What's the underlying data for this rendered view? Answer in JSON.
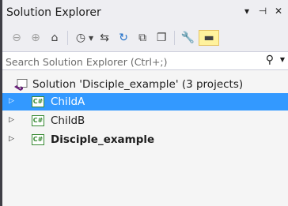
{
  "window": {
    "title": "Solution Explorer",
    "controls": [
      "▾",
      "⊣",
      "✕"
    ]
  },
  "toolbar": {
    "buttons": [
      {
        "name": "back",
        "glyph": "⊖"
      },
      {
        "name": "forward",
        "glyph": "⊕"
      },
      {
        "name": "home",
        "glyph": "⌂"
      },
      {
        "name": "pending-changes-filter",
        "glyph": "◷"
      },
      {
        "name": "sync",
        "glyph": "⇆"
      },
      {
        "name": "refresh",
        "glyph": "↻"
      },
      {
        "name": "collapse-all",
        "glyph": "⧉"
      },
      {
        "name": "show-all-files",
        "glyph": "❐"
      },
      {
        "name": "properties",
        "glyph": "🔧"
      },
      {
        "name": "preview",
        "glyph": "▬"
      }
    ]
  },
  "search": {
    "placeholder": "Search Solution Explorer (Ctrl+;)",
    "icon": "search-icon"
  },
  "tree": {
    "solution": {
      "label": "Solution 'Disciple_example' (3 projects)"
    },
    "projects": [
      {
        "label": "ChildA",
        "icon_text": "C#",
        "selected": true,
        "bold": false
      },
      {
        "label": "ChildB",
        "icon_text": "C#",
        "selected": false,
        "bold": false
      },
      {
        "label": "Disciple_example",
        "icon_text": "C#",
        "selected": false,
        "bold": true
      }
    ]
  },
  "colors": {
    "selection": "#3399ff",
    "background": "#f5f5f5",
    "chrome": "#eeeef2",
    "csharp_green": "#388a34",
    "vs_purple": "#68217a"
  }
}
